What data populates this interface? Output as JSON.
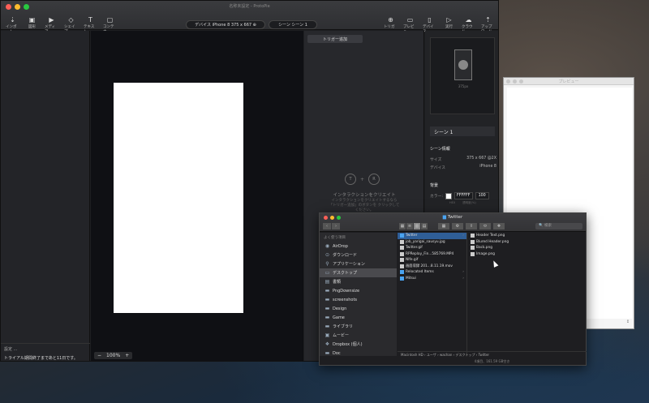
{
  "app": {
    "title": "名称未設定 - ProtoPie",
    "toolbar_left": [
      {
        "label": "インポート",
        "glyph": "⇣",
        "icon": "import-icon"
      },
      {
        "label": "図形",
        "glyph": "▣",
        "icon": "image-icon"
      },
      {
        "label": "メディア",
        "glyph": "▶",
        "icon": "media-icon"
      },
      {
        "label": "シェイプ",
        "glyph": "◇",
        "icon": "shape-icon"
      },
      {
        "label": "テキスト",
        "glyph": "T",
        "icon": "text-icon"
      },
      {
        "label": "コンテナー",
        "glyph": "▢",
        "icon": "container-icon"
      }
    ],
    "toolbar_right": [
      {
        "label": "トリガー",
        "glyph": "⊕",
        "icon": "trigger-icon"
      },
      {
        "label": "プレビュー",
        "glyph": "▭",
        "icon": "preview-icon"
      },
      {
        "label": "デバイス",
        "glyph": "▯",
        "icon": "device-icon"
      },
      {
        "label": "実行",
        "glyph": "▷",
        "icon": "run-icon"
      },
      {
        "label": "クラウド",
        "glyph": "☁",
        "icon": "cloud-icon"
      },
      {
        "label": "アップロード",
        "glyph": "⇡",
        "icon": "upload-icon"
      }
    ],
    "device_selector": "デバイス iPhone 8 375 x 667 ⊕",
    "scene_selector": "シーン シーン 1",
    "layers_footer_line1": "設定 ...",
    "layers_footer_line2": "トライアル期間終了まであと11日です。",
    "zoom": {
      "minus": "−",
      "value": "100%",
      "plus": "+"
    },
    "interactions": {
      "add_trigger": "トリガー追加",
      "trigger_letter": "T",
      "plus": "+",
      "response_letter": "R",
      "empty_title": "インタラクションをクリエイト",
      "empty_desc": "インタラクションをクリエイトするなら 「トリガー追加」のボタンを クリックしてください。"
    },
    "properties": {
      "size_label": "375px",
      "scene_name": "シーン 1",
      "scene_info_title": "シーン情報",
      "size_key": "サイズ",
      "size_value": "375 x 667 @2X",
      "device_key": "デバイス",
      "device_value": "iPhone 8",
      "background_title": "背景",
      "color_key": "カラー:",
      "color_hex": "FFFFFF",
      "opacity": "100",
      "hex_sub": "HEX",
      "opacity_sub": "透明度(%)"
    }
  },
  "preview_window": {
    "title": "プレビュー",
    "icon_glyph": "↕"
  },
  "finder": {
    "title": "Twitter",
    "folder_glyph": "▆",
    "back": "‹",
    "forward": "›",
    "views": [
      "▦",
      "≡",
      "▥",
      "▤"
    ],
    "tools": [
      "▦",
      "⚙",
      "⇪",
      "⬭",
      "❖"
    ],
    "search_placeholder": "🔍 検索",
    "sidebar_heading": "よく使う項目",
    "sidebar": [
      {
        "label": "AirDrop",
        "glyph": "◉",
        "icon": "airdrop-icon",
        "selected": false
      },
      {
        "label": "ダウンロード",
        "glyph": "⊙",
        "icon": "download-icon",
        "selected": false
      },
      {
        "label": "アプリケーション",
        "glyph": "⚲",
        "icon": "applications-icon",
        "selected": false
      },
      {
        "label": "デスクトップ",
        "glyph": "▭",
        "icon": "desktop-icon",
        "selected": true
      },
      {
        "label": "書類",
        "glyph": "▤",
        "icon": "documents-icon",
        "selected": false
      },
      {
        "label": "PngDownsize",
        "glyph": "▬",
        "icon": "folder-icon",
        "selected": false
      },
      {
        "label": "screenshots",
        "glyph": "▬",
        "icon": "folder-icon",
        "selected": false
      },
      {
        "label": "Design",
        "glyph": "▬",
        "icon": "folder-icon",
        "selected": false
      },
      {
        "label": "Game",
        "glyph": "▬",
        "icon": "folder-icon",
        "selected": false
      },
      {
        "label": "ライブラリ",
        "glyph": "▬",
        "icon": "folder-icon",
        "selected": false
      },
      {
        "label": "ムービー",
        "glyph": "▣",
        "icon": "movies-icon",
        "selected": false
      },
      {
        "label": "Dropbox (個人)",
        "glyph": "❖",
        "icon": "dropbox-icon",
        "selected": false
      },
      {
        "label": "Doc",
        "glyph": "▬",
        "icon": "folder-icon",
        "selected": false
      }
    ],
    "column1": [
      {
        "name": "Twitter",
        "folder": true,
        "selected": true
      },
      {
        "name": "job_yarigai_sausyu.jpg",
        "folder": false,
        "selected": false
      },
      {
        "name": "Twitter.gif",
        "folder": false,
        "selected": false
      },
      {
        "name": "RPReplay_Fin...585769.MP4",
        "folder": false,
        "selected": false
      },
      {
        "name": "Nlfe.gif",
        "folder": false,
        "selected": false
      },
      {
        "name": "画面収録 201...8.11.19.mov",
        "folder": false,
        "selected": false
      },
      {
        "name": "Relocated Items",
        "folder": true,
        "selected": false
      },
      {
        "name": "Mitsui",
        "folder": true,
        "selected": false
      }
    ],
    "column2": [
      {
        "name": "Header Text.png"
      },
      {
        "name": "Blured Header.png"
      },
      {
        "name": "Back.png"
      },
      {
        "name": "Image.png"
      }
    ],
    "chevron": "›",
    "path": "Macintosh HD › ユーザ › wachan › デスクトップ › Twitter",
    "status": "4項目、161.59 GB空き"
  }
}
